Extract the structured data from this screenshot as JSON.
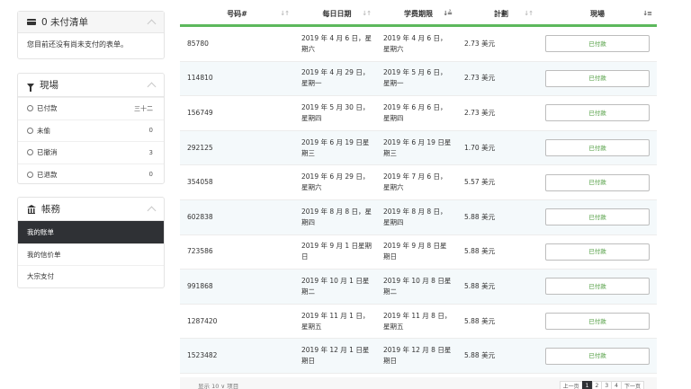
{
  "sidebar": {
    "unpaid": {
      "title": "0 未付清单",
      "message": "您目前还没有尚未支付的表单。"
    },
    "status": {
      "title": "現場",
      "items": [
        {
          "label": "已付款",
          "count": "三十二"
        },
        {
          "label": "未偷",
          "count": "0"
        },
        {
          "label": "已撤消",
          "count": "3"
        },
        {
          "label": "已退款",
          "count": "0"
        }
      ]
    },
    "billing": {
      "title": "帳務",
      "items": [
        {
          "label": "我的账单",
          "active": true
        },
        {
          "label": "我的信价单",
          "active": false
        },
        {
          "label": "大宗支付",
          "active": false
        }
      ]
    }
  },
  "table": {
    "headers": [
      "号码#",
      "每日日期",
      "学费期限",
      "計劃",
      "現場"
    ],
    "rows": [
      {
        "id": "85780",
        "date": "2019 年 4 月 6 日，星期六",
        "due": "2019 年 4 月 6 日，星期六",
        "amount": "2.73 美元",
        "status": "已付款"
      },
      {
        "id": "114810",
        "date": "2019 年 4 月 29 日，星期一",
        "due": "2019 年 5 月 6 日，星期一",
        "amount": "2.73 美元",
        "status": "已付款"
      },
      {
        "id": "156749",
        "date": "2019 年 5 月 30 日，星期四",
        "due": "2019 年 6 月 6 日，星期四",
        "amount": "2.73 美元",
        "status": "已付款"
      },
      {
        "id": "292125",
        "date": "2019 年 6 月 19 日星期三",
        "due": "2019 年 6 月 19 日星期三",
        "amount": "1.70 美元",
        "status": "已付款"
      },
      {
        "id": "354058",
        "date": "2019 年 6 月 29 日，星期六",
        "due": "2019 年 7 月 6 日，星期六",
        "amount": "5.57 美元",
        "status": "已付款"
      },
      {
        "id": "602838",
        "date": "2019 年 8 月 8 日，星期四",
        "due": "2019 年 8 月 8 日，星期四",
        "amount": "5.88 美元",
        "status": "已付款"
      },
      {
        "id": "723586",
        "date": "2019 年 9 月 1 日星期日",
        "due": "2019 年 9 月 8 日星期日",
        "amount": "5.88 美元",
        "status": "已付款"
      },
      {
        "id": "991868",
        "date": "2019 年 10 月 1 日星期二",
        "due": "2019 年 10 月 8 日星期二",
        "amount": "5.88 美元",
        "status": "已付款"
      },
      {
        "id": "1287420",
        "date": "2019 年 11 月 1 日，星期五",
        "due": "2019 年 11 月 8 日，星期五",
        "amount": "5.88 美元",
        "status": "已付款"
      },
      {
        "id": "1523482",
        "date": "2019 年 12 月 1 日星期日",
        "due": "2019 年 12 月 8 日星期日",
        "amount": "5.88 美元",
        "status": "已付款"
      }
    ]
  },
  "footer": {
    "per_page": "显示 10 ∨ 项目",
    "pagination": {
      "prev": "上一页",
      "pages": [
        "1",
        "2",
        "3",
        "4"
      ],
      "next": "下一页",
      "current": "1"
    }
  },
  "colors": {
    "accent_green": "#5cb85c",
    "dark": "#2f3135",
    "paid_text": "#4a9a3a"
  }
}
